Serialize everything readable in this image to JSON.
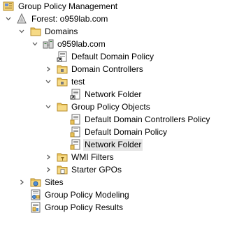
{
  "tree": {
    "root": {
      "label": "Group Policy Management",
      "icon": "gpmc-icon"
    },
    "forest": {
      "label": "Forest: o959lab.com",
      "icon": "forest-icon",
      "expanded": true
    },
    "domains": {
      "label": "Domains",
      "icon": "folder-icon",
      "expanded": true
    },
    "domain": {
      "label": "o959lab.com",
      "icon": "domain-icon",
      "expanded": true
    },
    "default_domain_policy_link": {
      "label": "Default Domain Policy",
      "icon": "gpo-link-icon"
    },
    "domain_controllers": {
      "label": "Domain Controllers",
      "icon": "ou-folder-icon",
      "expanded": false
    },
    "test_ou": {
      "label": "test",
      "icon": "ou-folder-icon",
      "expanded": true
    },
    "network_folder_link": {
      "label": "Network Folder",
      "icon": "gpo-link-icon"
    },
    "gpo_container": {
      "label": "Group Policy Objects",
      "icon": "folder-icon",
      "expanded": true
    },
    "gpo_items": [
      {
        "label": "Default Domain Controllers Policy",
        "icon": "gpo-icon"
      },
      {
        "label": "Default Domain Policy",
        "icon": "gpo-icon"
      },
      {
        "label": "Network Folder",
        "icon": "gpo-icon",
        "selected": true
      }
    ],
    "wmi_filters": {
      "label": "WMI Filters",
      "icon": "folder-icon",
      "expanded": false
    },
    "starter_gpos": {
      "label": "Starter GPOs",
      "icon": "folder-icon",
      "expanded": false
    },
    "sites": {
      "label": "Sites",
      "icon": "sites-icon",
      "expanded": false
    },
    "modeling": {
      "label": "Group Policy Modeling",
      "icon": "modeling-icon"
    },
    "results": {
      "label": "Group Policy Results",
      "icon": "results-icon"
    }
  },
  "colors": {
    "selection": "#e6e6e6",
    "folder": "#e8c25a",
    "twisty": "#555555"
  }
}
